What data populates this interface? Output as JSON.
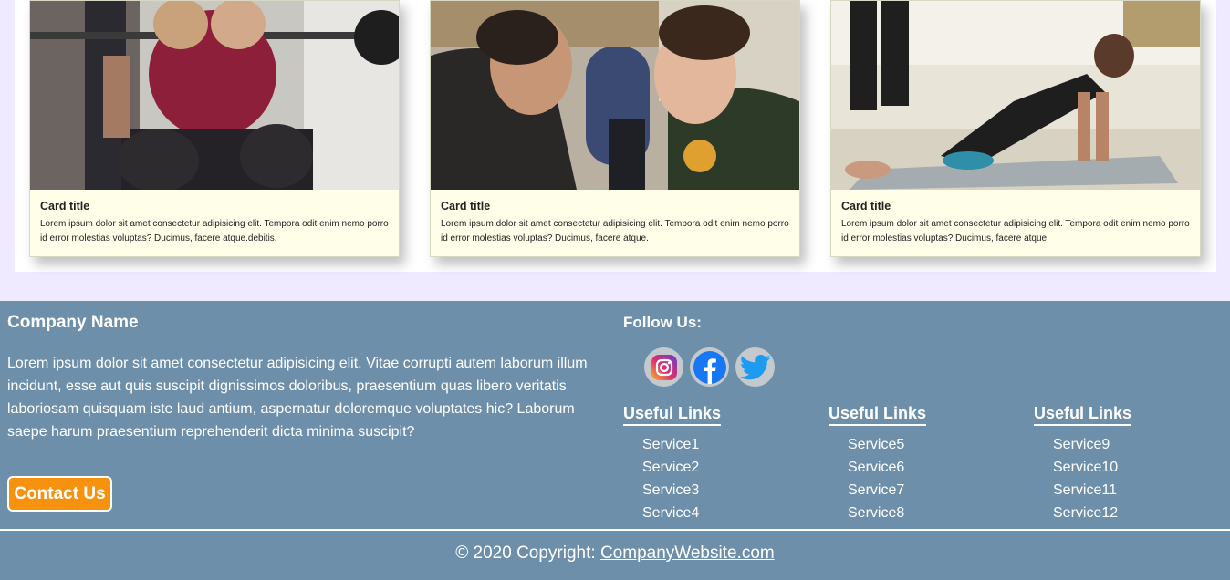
{
  "cards": [
    {
      "title": "Card title",
      "text": "Lorem ipsum dolor sit amet consectetur adipisicing elit. Tempora odit enim nemo porro id error molestias voluptas? Ducimus, facere atque.debitis."
    },
    {
      "title": "Card title",
      "text": "Lorem ipsum dolor sit amet consectetur adipisicing elit. Tempora odit enim nemo porro id error molestias voluptas? Ducimus, facere atque."
    },
    {
      "title": "Card title",
      "text": "Lorem ipsum dolor sit amet consectetur adipisicing elit. Tempora odit enim nemo porro id error molestias voluptas? Ducimus, facere atque."
    }
  ],
  "footer": {
    "company_name": "Company Name",
    "description": "Lorem ipsum dolor sit amet consectetur adipisicing elit. Vitae corrupti autem laborum illum incidunt, esse aut quis suscipit dignissimos doloribus, praesentium quas libero veritatis laboriosam quisquam iste laud antium, aspernatur doloremque voluptates hic? Laborum saepe harum praesentium reprehenderit dicta minima suscipit?",
    "contact_label": "Contact Us",
    "follow_title": "Follow Us:",
    "social": [
      "instagram-icon",
      "facebook-icon",
      "twitter-icon"
    ],
    "link_columns": [
      {
        "title": "Useful Links",
        "items": [
          "Service1",
          "Service2",
          "Service3",
          "Service4"
        ]
      },
      {
        "title": "Useful Links",
        "items": [
          "Service5",
          "Service6",
          "Service7",
          "Service8"
        ]
      },
      {
        "title": "Useful Links",
        "items": [
          "Service9",
          "Service10",
          "Service11",
          "Service12"
        ]
      }
    ],
    "copyright_prefix": "© 2020 Copyright: ",
    "copyright_link": "CompanyWebsite.com"
  },
  "colors": {
    "page_bg": "#efeaff",
    "card_bg": "#ffffe9",
    "footer_bg": "#6e8faa",
    "contact_button": "#f7920f"
  }
}
